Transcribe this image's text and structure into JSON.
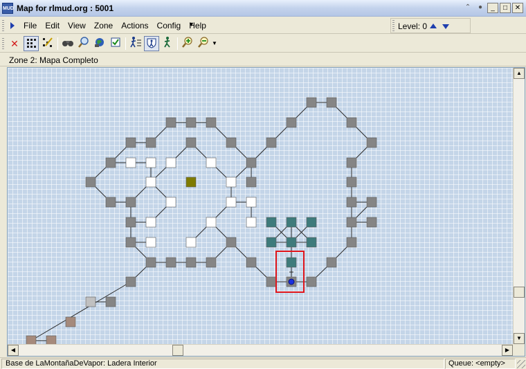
{
  "window": {
    "title": "Map for rlmud.org : 5001",
    "app_icon_text": "MUD",
    "controls": [
      "restore-up",
      "dot",
      "minimize",
      "maximize",
      "close"
    ]
  },
  "menu": {
    "items": [
      "File",
      "Edit",
      "View",
      "Zone",
      "Actions",
      "Config",
      "Help"
    ],
    "more": "▼"
  },
  "level": {
    "label": "Level: 0"
  },
  "toolbar": {
    "icons": [
      "delete-icon",
      "grid-view-icon",
      "random-layout-icon",
      "binoculars-icon",
      "magnifier-icon",
      "globe-icon",
      "check-box-icon",
      "walk-list-icon",
      "walk-shield-icon",
      "walk-icon",
      "zoom-in-icon",
      "zoom-out-icon"
    ]
  },
  "zone": {
    "label": "Zone 2: Mapa Completo"
  },
  "map": {
    "colors": {
      "background": "#c4d5e8",
      "room_gray": "#858585",
      "room_white": "#ffffff",
      "room_olive": "#7f7b00",
      "room_teal": "#3e7b7b",
      "room_light": "#c0c0c0",
      "room_tan": "#a58a7c",
      "current_marker": "#1a2fe0",
      "selection": "#e0151b"
    }
  },
  "status": {
    "main": "Base de LaMontañaDeVapor: Ladera Interior",
    "queue": "Queue: <empty>"
  }
}
